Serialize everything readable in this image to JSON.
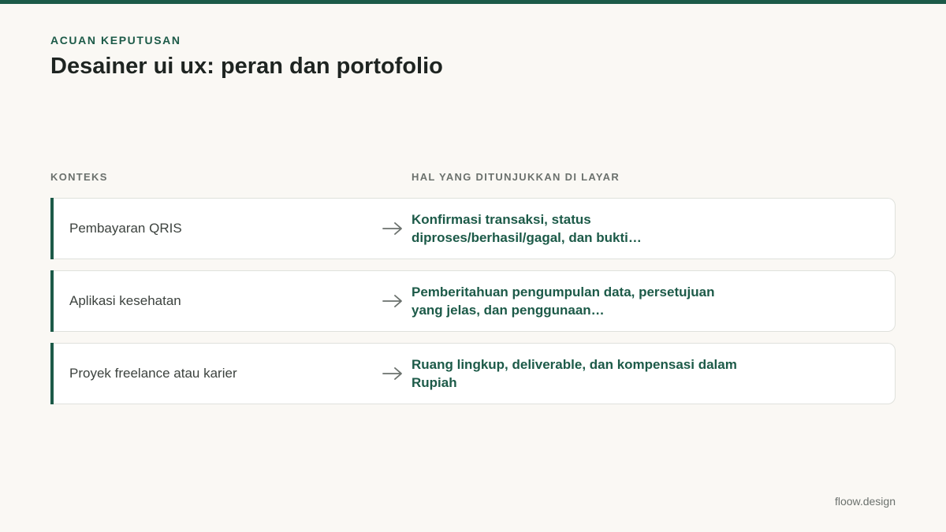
{
  "header": {
    "eyebrow": "ACUAN KEPUTUSAN",
    "title": "Desainer ui ux: peran dan portofolio"
  },
  "columns": {
    "context": "KONTEKS",
    "shown": "HAL YANG DITUNJUKKAN DI LAYAR"
  },
  "rows": [
    {
      "context": "Pembayaran QRIS",
      "detail": "Konfirmasi transaksi, status diproses/berhasil/gagal, dan bukti…"
    },
    {
      "context": "Aplikasi kesehatan",
      "detail": "Pemberitahuan pengumpulan data, persetujuan yang jelas, dan penggunaan…"
    },
    {
      "context": "Proyek freelance atau karier",
      "detail": "Ruang lingkup, deliverable, dan kompensasi dalam Rupiah"
    }
  ],
  "footer": {
    "brand": "floow.design"
  },
  "colors": {
    "accent": "#1c5a48",
    "background": "#faf8f4",
    "title": "#1e2421",
    "muted": "#6b716d"
  },
  "icons": {
    "row_arrow": "arrow-right-icon"
  }
}
